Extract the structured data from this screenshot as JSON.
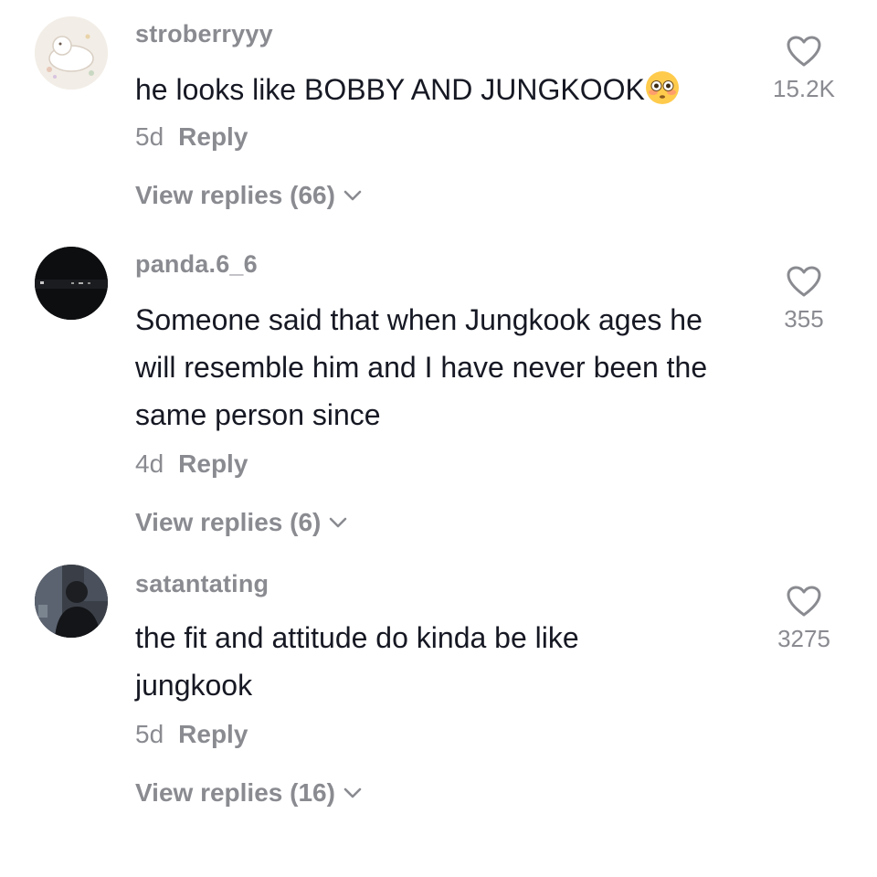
{
  "comments": [
    {
      "username": "stroberryyy",
      "text": "he looks like BOBBY AND JUNGKOOK",
      "emoji": "flushed-face-emoji",
      "time": "5d",
      "reply_label": "Reply",
      "view_replies": "View replies (66)",
      "likes": "15.2K"
    },
    {
      "username": "panda.6_6",
      "text": "Someone said that when Jungkook ages he will resemble him and I have never been the same person since",
      "time": "4d",
      "reply_label": "Reply",
      "view_replies": "View replies (6)",
      "likes": "355"
    },
    {
      "username": "satantating",
      "text": "the fit and attitude do kinda be like jungkook",
      "time": "5d",
      "reply_label": "Reply",
      "view_replies": "View replies (16)",
      "likes": "3275"
    }
  ],
  "icons": {
    "like": "heart-outline-icon",
    "expand": "chevron-down-icon"
  },
  "colors": {
    "text": "#161823",
    "secondary": "#8a8b91",
    "background": "#ffffff"
  }
}
